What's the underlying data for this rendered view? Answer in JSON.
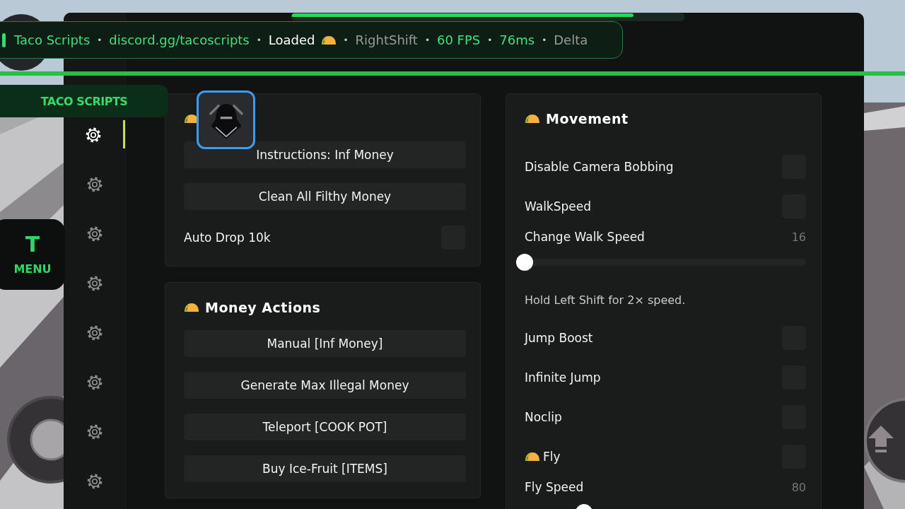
{
  "loading_bar": {
    "level": 0.87
  },
  "notification": {
    "separator": "•",
    "items": [
      {
        "text": "Taco Scripts",
        "kind": "accent",
        "taco": false
      },
      {
        "text": "discord.gg/tacoscripts",
        "kind": "accent",
        "taco": false
      },
      {
        "text": "Loaded",
        "kind": "plain",
        "taco": true
      },
      {
        "text": "RightShift",
        "kind": "muted",
        "taco": false
      },
      {
        "text": "60 FPS",
        "kind": "accent",
        "taco": false
      },
      {
        "text": "76ms",
        "kind": "accent",
        "taco": false
      },
      {
        "text": "Delta",
        "kind": "muted",
        "taco": false
      }
    ]
  },
  "brand_tab": {
    "label": "TACO SCRIPTS"
  },
  "menu_button": {
    "letter": "T",
    "label": "MENU"
  },
  "sidebar": {
    "items": [
      {
        "selected": true
      },
      {
        "selected": false
      },
      {
        "selected": false
      },
      {
        "selected": false
      },
      {
        "selected": false
      },
      {
        "selected": false
      },
      {
        "selected": false
      },
      {
        "selected": false
      }
    ]
  },
  "left_cards": [
    {
      "items": [
        {
          "kind": "button",
          "label": "Instructions: Inf Money"
        },
        {
          "kind": "button",
          "label": "Clean All Filthy Money"
        },
        {
          "kind": "toggle",
          "label": "Auto Drop 10k",
          "checked": false,
          "taco": false
        }
      ]
    },
    {
      "title": "Money Actions",
      "items": [
        {
          "kind": "button",
          "label": "Manual [Inf Money]"
        },
        {
          "kind": "button",
          "label": "Generate Max Illegal Money"
        },
        {
          "kind": "button",
          "label": "Teleport [COOK POT]"
        },
        {
          "kind": "button",
          "label": "Buy Ice-Fruit [ITEMS]"
        }
      ]
    }
  ],
  "right_card": {
    "title": "Movement",
    "items": [
      {
        "kind": "toggle",
        "label": "Disable Camera Bobbing",
        "checked": false,
        "taco": false
      },
      {
        "kind": "toggle",
        "label": "WalkSpeed",
        "checked": false,
        "taco": false
      },
      {
        "kind": "slider",
        "label": "Change Walk Speed",
        "value": "16",
        "level": 0
      },
      {
        "kind": "note",
        "text": "Hold Left Shift for 2× speed."
      },
      {
        "kind": "toggle",
        "label": "Jump Boost",
        "checked": false,
        "taco": false
      },
      {
        "kind": "toggle",
        "label": "Infinite Jump",
        "checked": false,
        "taco": false
      },
      {
        "kind": "toggle",
        "label": "Noclip",
        "checked": false,
        "taco": false
      },
      {
        "kind": "toggle",
        "label": "Fly",
        "checked": false,
        "taco": true
      },
      {
        "kind": "slider",
        "label": "Fly Speed",
        "value": "80",
        "level": 0.21
      }
    ]
  }
}
